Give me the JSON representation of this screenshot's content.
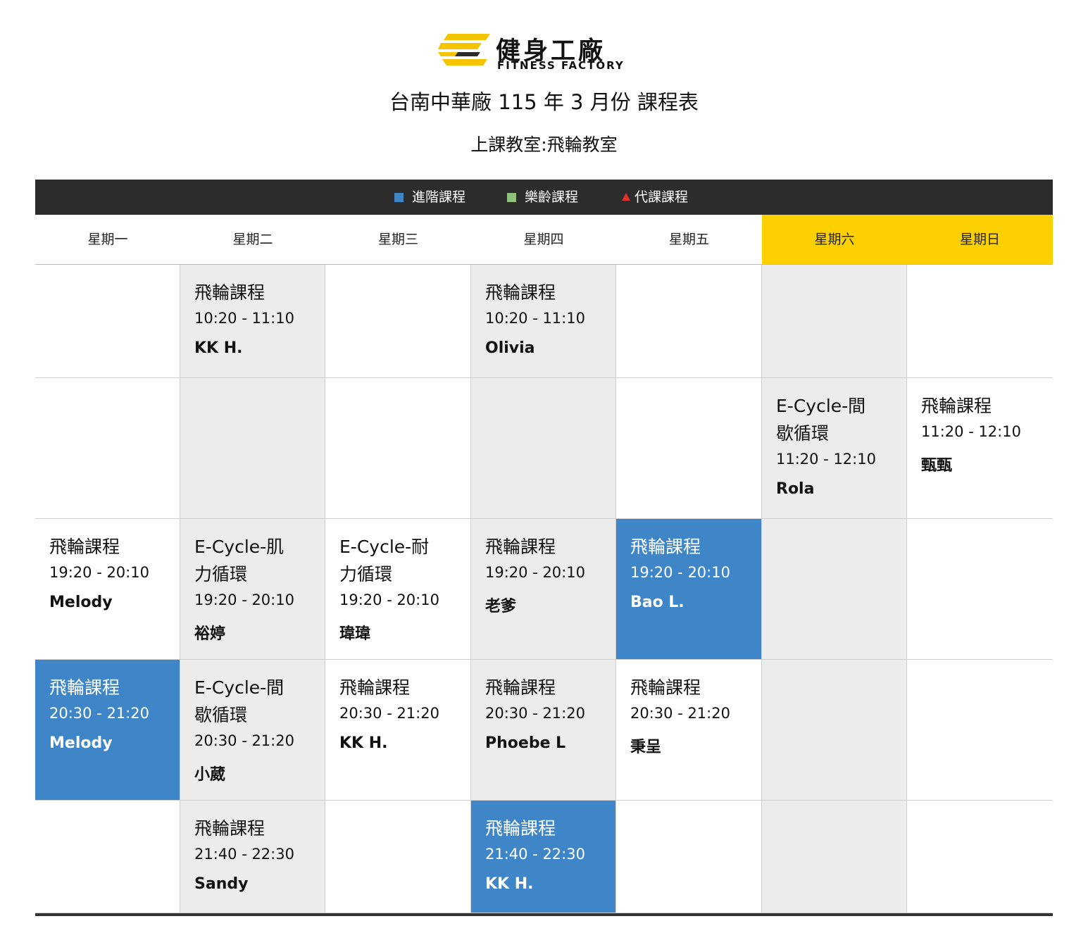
{
  "brand": {
    "name_cn": "健身工廠",
    "name_en": "FITNESS FACTORY",
    "logo_colors": [
      "#f5c400",
      "#2a2a2a"
    ]
  },
  "title": "台南中華廠 115 年 3 月份 課程表",
  "subtitle": "上課教室:飛輪教室",
  "legend": [
    {
      "label": "進階課程",
      "marker": "square",
      "color": "#3f86c9"
    },
    {
      "label": "樂齡課程",
      "marker": "square",
      "color": "#8fc17a"
    },
    {
      "label": "代課課程",
      "marker": "triangle",
      "color": "#e53030"
    }
  ],
  "days": [
    "星期一",
    "星期二",
    "星期三",
    "星期四",
    "星期五",
    "星期六",
    "星期日"
  ],
  "colors": {
    "weekend_header": "#ffd000",
    "advanced": "#3f86c9",
    "grey_cell": "#ececec",
    "legend_bar": "#2c2c2c"
  },
  "schedule": [
    {
      "slots": [
        null,
        {
          "course": "飛輪課程",
          "time": "10:20 - 11:10",
          "coach": "KK H."
        },
        null,
        {
          "course": "飛輪課程",
          "time": "10:20 - 11:10",
          "coach": "Olivia"
        },
        null,
        null,
        null
      ]
    },
    {
      "slots": [
        null,
        null,
        null,
        null,
        null,
        {
          "course": "E-Cycle-間歇循環",
          "course_lines": [
            "E-Cycle-間",
            "歇循環"
          ],
          "time": "11:20 - 12:10",
          "coach": "Rola"
        },
        {
          "course": "飛輪課程",
          "time": "11:20 - 12:10",
          "coach": "甄甄"
        }
      ]
    },
    {
      "slots": [
        {
          "course": "飛輪課程",
          "time": "19:20 - 20:10",
          "coach": "Melody"
        },
        {
          "course": "E-Cycle-肌力循環",
          "course_lines": [
            "E-Cycle-肌",
            "力循環"
          ],
          "time": "19:20 - 20:10",
          "coach": "裕婷"
        },
        {
          "course": "E-Cycle-耐力循環",
          "course_lines": [
            "E-Cycle-耐",
            "力循環"
          ],
          "time": "19:20 - 20:10",
          "coach": "瑋瑋"
        },
        {
          "course": "飛輪課程",
          "time": "19:20 - 20:10",
          "coach": "老爹"
        },
        {
          "course": "飛輪課程",
          "time": "19:20 - 20:10",
          "coach": "Bao L.",
          "type": "advanced"
        },
        null,
        null
      ]
    },
    {
      "slots": [
        {
          "course": "飛輪課程",
          "time": "20:30 - 21:20",
          "coach": "Melody",
          "type": "advanced"
        },
        {
          "course": "E-Cycle-間歇循環",
          "course_lines": [
            "E-Cycle-間",
            "歇循環"
          ],
          "time": "20:30 - 21:20",
          "coach": "小葳"
        },
        {
          "course": "飛輪課程",
          "time": "20:30 - 21:20",
          "coach": "KK H."
        },
        {
          "course": "飛輪課程",
          "time": "20:30 - 21:20",
          "coach": "Phoebe L"
        },
        {
          "course": "飛輪課程",
          "time": "20:30 - 21:20",
          "coach": "秉呈"
        },
        null,
        null
      ]
    },
    {
      "slots": [
        null,
        {
          "course": "飛輪課程",
          "time": "21:40 - 22:30",
          "coach": "Sandy"
        },
        null,
        {
          "course": "飛輪課程",
          "time": "21:40 - 22:30",
          "coach": "KK H.",
          "type": "advanced"
        },
        null,
        null,
        null
      ]
    }
  ]
}
